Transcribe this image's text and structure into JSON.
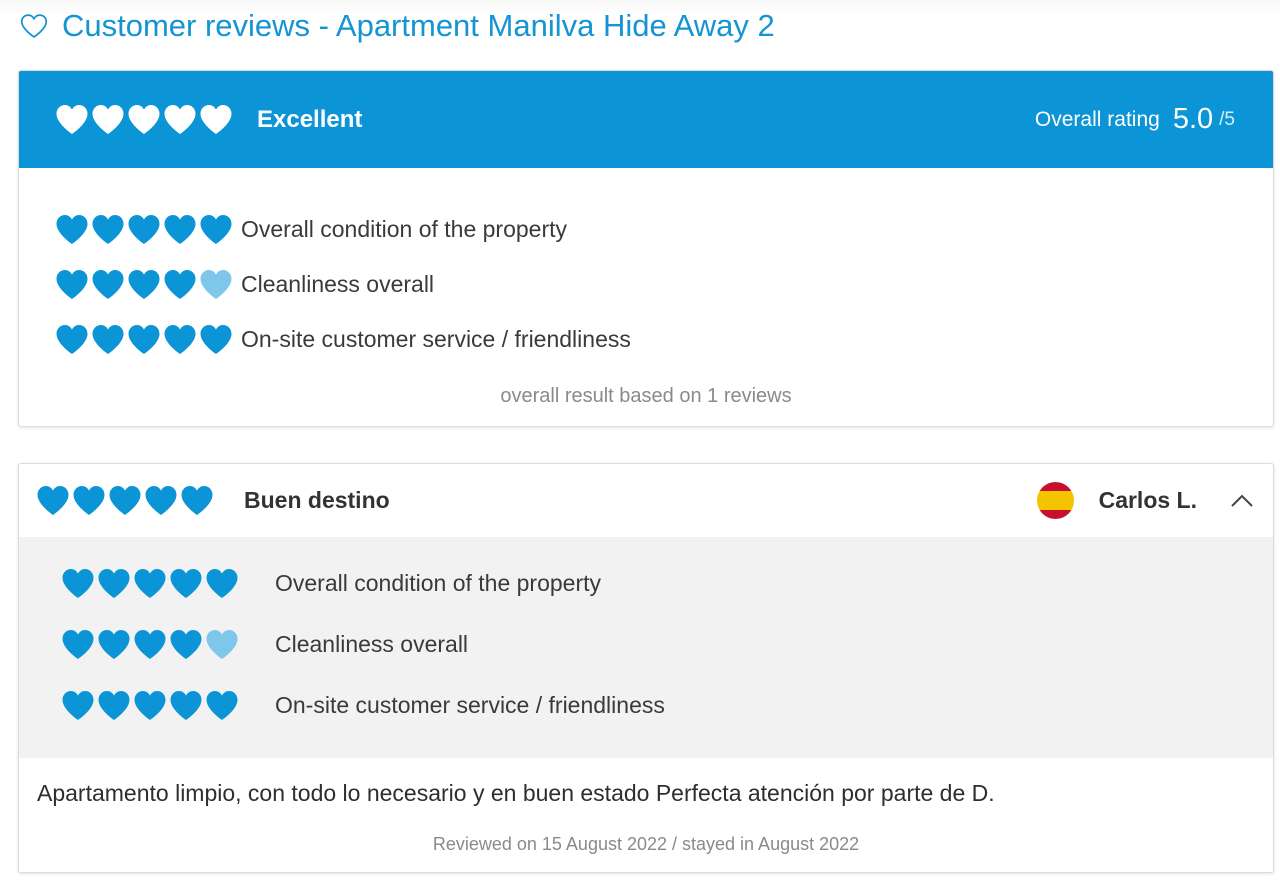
{
  "page": {
    "title": "Customer reviews - Apartment Manilva Hide Away 2"
  },
  "colors": {
    "accent": "#0c95d6",
    "heart_full": "#0c95d6",
    "heart_light": "#7fc7ea",
    "heart_white": "#ffffff",
    "title_text": "#1594d3"
  },
  "summary": {
    "hearts": 5,
    "verdict": "Excellent",
    "overall_label": "Overall rating",
    "overall_score": "5.0",
    "overall_max": "/5",
    "criteria": [
      {
        "label": "Overall condition of the property",
        "rating": 5
      },
      {
        "label": "Cleanliness overall",
        "rating": 4
      },
      {
        "label": "On-site customer service / friendliness",
        "rating": 5
      }
    ],
    "footer": "overall result based on 1 reviews"
  },
  "review": {
    "rating": 5,
    "title": "Buen destino",
    "reviewer_name": "Carlos L.",
    "reviewer_flag": "spain-flag",
    "criteria": [
      {
        "label": "Overall condition of the property",
        "rating": 5
      },
      {
        "label": "Cleanliness overall",
        "rating": 4
      },
      {
        "label": "On-site customer service / friendliness",
        "rating": 5
      }
    ],
    "text": "Apartamento limpio, con todo lo necesario y en buen estado Perfecta atención por parte de D.",
    "meta": "Reviewed on 15 August 2022 / stayed in August 2022"
  }
}
